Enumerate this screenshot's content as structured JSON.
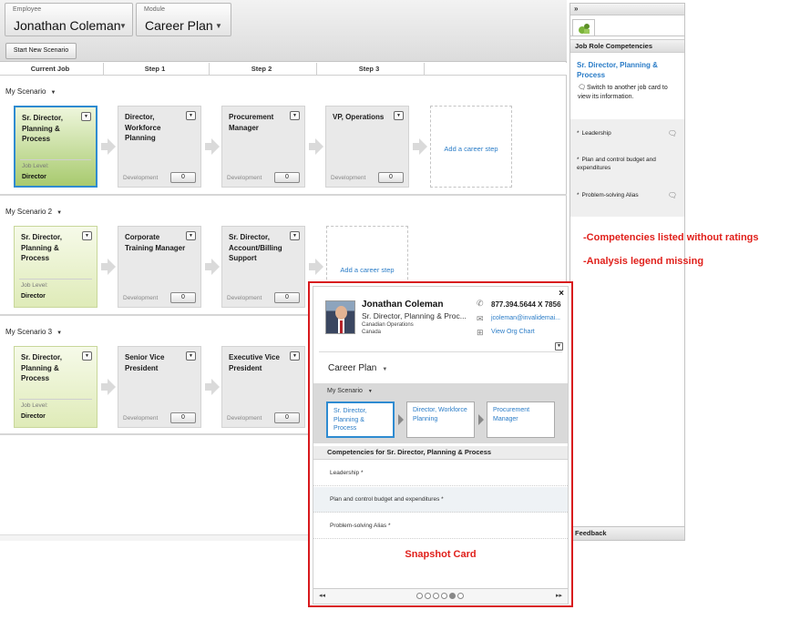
{
  "header": {
    "employee_caption": "Employee",
    "employee_value": "Jonathan Coleman",
    "module_caption": "Module",
    "module_value": "Career Plan",
    "start_button": "Start New Scenario"
  },
  "columns": [
    "Current Job",
    "Step 1",
    "Step 2",
    "Step 3"
  ],
  "scenarios": [
    {
      "title": "My Scenario",
      "current": {
        "title": "Sr. Director, Planning & Process",
        "level_label": "Job Level:",
        "level_value": "Director"
      },
      "steps": [
        {
          "title": "Director, Workforce Planning",
          "dev_label": "Development",
          "count": "0"
        },
        {
          "title": "Procurement Manager",
          "dev_label": "Development",
          "count": "0"
        },
        {
          "title": "VP, Operations",
          "dev_label": "Development",
          "count": "0"
        }
      ],
      "add_label": "Add a career step"
    },
    {
      "title": "My Scenario 2",
      "current": {
        "title": "Sr. Director, Planning & Process",
        "level_label": "Job Level:",
        "level_value": "Director"
      },
      "steps": [
        {
          "title": "Corporate Training Manager",
          "dev_label": "Development",
          "count": "0"
        },
        {
          "title": "Sr. Director, Account/Billing Support",
          "dev_label": "Development",
          "count": "0"
        }
      ],
      "add_label": "Add a career step"
    },
    {
      "title": "My Scenario 3",
      "current": {
        "title": "Sr. Director, Planning & Process",
        "level_label": "Job Level:",
        "level_value": "Director"
      },
      "steps": [
        {
          "title": "Senior Vice President",
          "dev_label": "Development",
          "count": "0"
        },
        {
          "title": "Executive Vice President",
          "dev_label": "Development",
          "count": "0"
        }
      ]
    }
  ],
  "side": {
    "collapse": "»",
    "heading": "Job Role Competencies",
    "role": "Sr. Director, Planning & Process",
    "info": "Switch to another job card to view its information.",
    "competencies": [
      "Leadership",
      "Plan and control budget and expenditures",
      "Problem-solving Alias"
    ],
    "feedback": "Feedback"
  },
  "notes": {
    "note1": "-Competencies listed without ratings",
    "note2": "-Analysis legend missing"
  },
  "snapshot": {
    "close": "×",
    "name": "Jonathan Coleman",
    "role": "Sr. Director, Planning & Proc...",
    "org": "Canadian Operations",
    "country": "Canada",
    "phone": "877.394.5644 X 7856",
    "email": "jcoleman@invalidemai...",
    "org_chart": "View Org Chart",
    "module": "Career Plan",
    "scenario": "My Scenario",
    "mini_cards": [
      "Sr. Director, Planning & Process",
      "Director, Workforce Planning",
      "Procurement Manager"
    ],
    "comp_heading": "Competencies for Sr. Director, Planning & Process",
    "comp_rows": [
      "Leadership *",
      "Plan and control budget and expenditures *",
      "Problem-solving Alias *"
    ],
    "label": "Snapshot Card",
    "prev": "◂◂",
    "next": "▸▸",
    "page_dots_total": 6,
    "page_dots_active": 5
  },
  "colors": {
    "accent": "#2a7cc7",
    "annotation": "#e0201b",
    "selected_border": "#2e8bd1"
  }
}
